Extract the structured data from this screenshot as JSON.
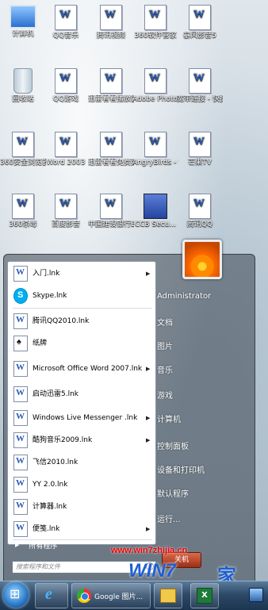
{
  "desktop": {
    "icons": [
      {
        "label": "计算机",
        "type": "computer"
      },
      {
        "label": "QQ音乐",
        "type": "word"
      },
      {
        "label": "腾讯视频",
        "type": "word"
      },
      {
        "label": "360软件管家",
        "type": "word"
      },
      {
        "label": "暴风影音5",
        "type": "word"
      },
      {
        "label": "回收站",
        "type": "bin"
      },
      {
        "label": "QQ游戏",
        "type": "word"
      },
      {
        "label": "迅雷看看播放器快捷方式",
        "type": "word"
      },
      {
        "label": "Adobe Photosh...",
        "type": "word"
      },
      {
        "label": "宽带连接 - 快捷方式",
        "type": "word"
      },
      {
        "label": "360安全浏览器",
        "type": "word"
      },
      {
        "label": "Word 2003",
        "type": "word"
      },
      {
        "label": "迅雷看看免费高清电影",
        "type": "word"
      },
      {
        "label": "AngryBirds - 快捷方式",
        "type": "word"
      },
      {
        "label": "芒果TV",
        "type": "word"
      },
      {
        "label": "360杀毒",
        "type": "word"
      },
      {
        "label": "百度影音",
        "type": "word"
      },
      {
        "label": "中国建设银行E路护航...",
        "type": "word"
      },
      {
        "label": "CCB Secu...",
        "type": "ccb"
      },
      {
        "label": "腾讯QQ",
        "type": "word"
      }
    ]
  },
  "start_menu": {
    "programs": [
      {
        "label": "入门.lnk",
        "icon": "word-icon",
        "arrow": "▶"
      },
      {
        "label": "Skype.lnk",
        "icon": "skype-icon",
        "arrow": ""
      },
      {
        "label": "腾讯QQ2010.lnk",
        "icon": "word-icon",
        "arrow": ""
      },
      {
        "label": "纸牌",
        "icon": "cards-icon",
        "arrow": ""
      },
      {
        "label": "Microsoft Office Word 2007.lnk",
        "icon": "word-icon",
        "arrow": "▶"
      },
      {
        "label": "启动迅雷5.lnk",
        "icon": "word-icon",
        "arrow": ""
      },
      {
        "label": "Windows Live Messenger .lnk",
        "icon": "word-icon",
        "arrow": "▶"
      },
      {
        "label": "酷狗音乐2009.lnk",
        "icon": "word-icon",
        "arrow": "▶"
      },
      {
        "label": "飞信2010.lnk",
        "icon": "word-icon",
        "arrow": ""
      },
      {
        "label": "YY 2.0.lnk",
        "icon": "word-icon",
        "arrow": ""
      },
      {
        "label": "计算器.lnk",
        "icon": "word-icon",
        "arrow": ""
      },
      {
        "label": "便笺.lnk",
        "icon": "word-icon",
        "arrow": "▶"
      }
    ],
    "all_programs": "所有程序",
    "all_programs_arrow": "▶",
    "search_placeholder": "搜索程序和文件",
    "right_items": [
      "Administrator",
      "文档",
      "图片",
      "音乐",
      "游戏",
      "计算机",
      "控制面板",
      "设备和打印机",
      "默认程序",
      "运行..."
    ],
    "shutdown_label": "关机"
  },
  "watermark": {
    "url": "www.win7zhijia.cn",
    "logo": "WIN7",
    "logo_cn": "家"
  },
  "taskbar": {
    "chrome_label": "Google 图片...",
    "excel_label": "X"
  },
  "colors": {
    "accent": "#2a78c8",
    "watermark_red": "#ee0000",
    "watermark_blue": "#1e5fd2"
  }
}
